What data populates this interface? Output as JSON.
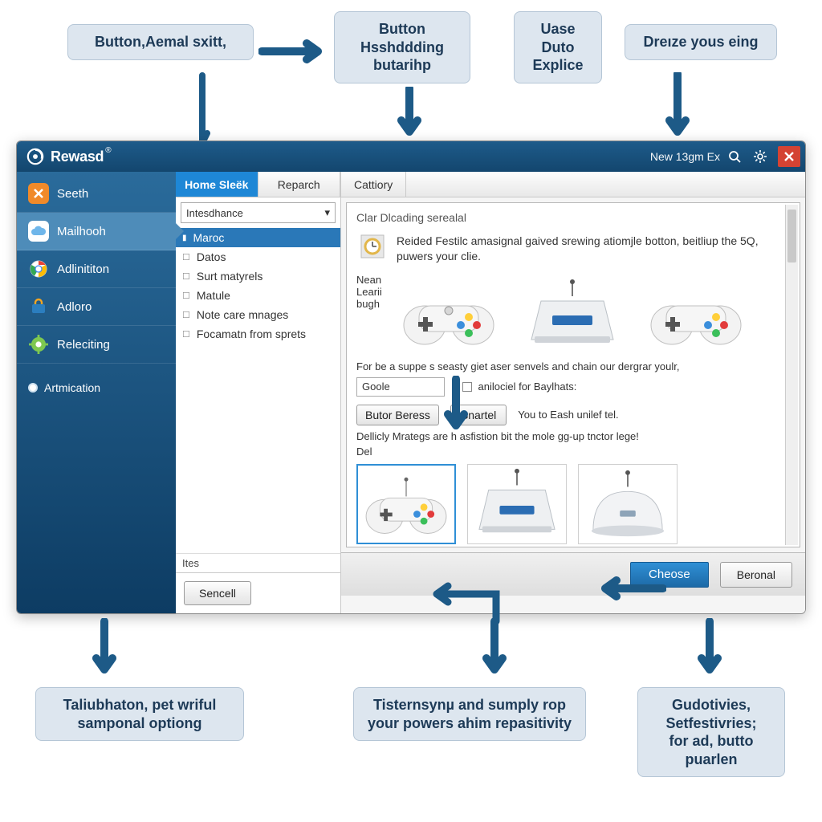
{
  "callouts": {
    "top1": "Button,Aemal sxitt,",
    "top2": "Button\nHsshddding butarihp",
    "top3": "Uase\nDuto\nExplice",
    "top4": "Dreıze yous eing",
    "bottom1": "Taliubhaton, pet wriful samponal optiong",
    "bottom2": "Tisternsynµ and sumply rop your powers ahim repasitivity",
    "bottom3": "Gudotivies,\nSetfestivries;\nfor ad, butto puarlen"
  },
  "titlebar": {
    "app": "Rewasd",
    "doc": "New 13gm  Ex"
  },
  "sidebar": {
    "items": [
      {
        "label": "Seeth"
      },
      {
        "label": "Mailhooh"
      },
      {
        "label": "Adlinititon"
      },
      {
        "label": "Adloro"
      },
      {
        "label": "Releciting"
      }
    ],
    "footer": "Artmication"
  },
  "tabs": {
    "a": "Home Sleëk",
    "b": "Reparch",
    "contentTab": "Cattiory"
  },
  "combo": "Intesdhance",
  "list": [
    "Maroc",
    "Datos",
    "Surt matyrels",
    "Matule",
    "Note care mnages",
    "Focamatn from sprets"
  ],
  "panel": {
    "miniLabel": "Ites",
    "cancel": "Sencell",
    "title": "Clar Dlcading serealal",
    "desc": "Reided Festilc amasignal gaived srewing atiomjle botton, beitliup the 5Q, puwers your clie.",
    "sideLabels": "Nean\nLearii\nbugh",
    "supportLine": "For be a suppe s seasty giet aser senvels and chain our dergrar youlr,",
    "googleInput": "Goole",
    "checkboxLabel": "anilociel for Baylhats:",
    "btn1": "Butor Beress",
    "btn2": "Snartel",
    "trail": "You to Eash unilef tel.",
    "note": "Dellicly Mrategs are h asfistion bit the mole gg-up tnctor lege!",
    "noteShort": "Del"
  },
  "footer": {
    "choose": "Cheose",
    "secondary": "Beronal"
  },
  "icons": {
    "seeth": "orange-x",
    "mailhooh": "cloud",
    "adlinititon": "chrome",
    "adloro": "lockbag",
    "releciting": "gear"
  }
}
